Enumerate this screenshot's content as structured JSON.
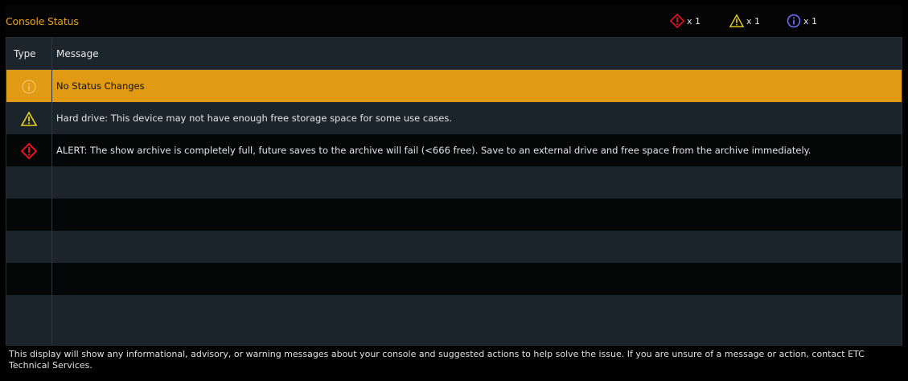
{
  "window": {
    "title": "Console Status"
  },
  "counters": {
    "alert": {
      "icon": "alert-icon",
      "label": "x 1",
      "color": "#e8101e"
    },
    "warning": {
      "icon": "warning-icon",
      "label": "x 1",
      "color": "#e8d21a"
    },
    "info": {
      "icon": "info-icon",
      "label": "x 1",
      "color": "#6a6cf5"
    }
  },
  "table": {
    "columns": [
      "Type",
      "Message"
    ],
    "rows": [
      {
        "type": "info",
        "icon": "info-icon",
        "message": "No Status Changes",
        "selected": true
      },
      {
        "type": "warning",
        "icon": "warning-icon",
        "message": "Hard drive: This device may not have enough free storage space for some use cases."
      },
      {
        "type": "alert",
        "icon": "alert-icon",
        "message": "ALERT: The show archive is completely full, future saves to the archive will fail (<666 free). Save to an external drive and free space from the archive immediately."
      }
    ]
  },
  "footer": {
    "text": "This display will show any informational, advisory, or warning messages about your console and suggested actions to help solve the issue. If you are unsure of a message or action, contact ETC Technical Services."
  },
  "colors": {
    "accent": "#e09a14",
    "title": "#e8a21c",
    "header_bg": "#1c242c"
  }
}
